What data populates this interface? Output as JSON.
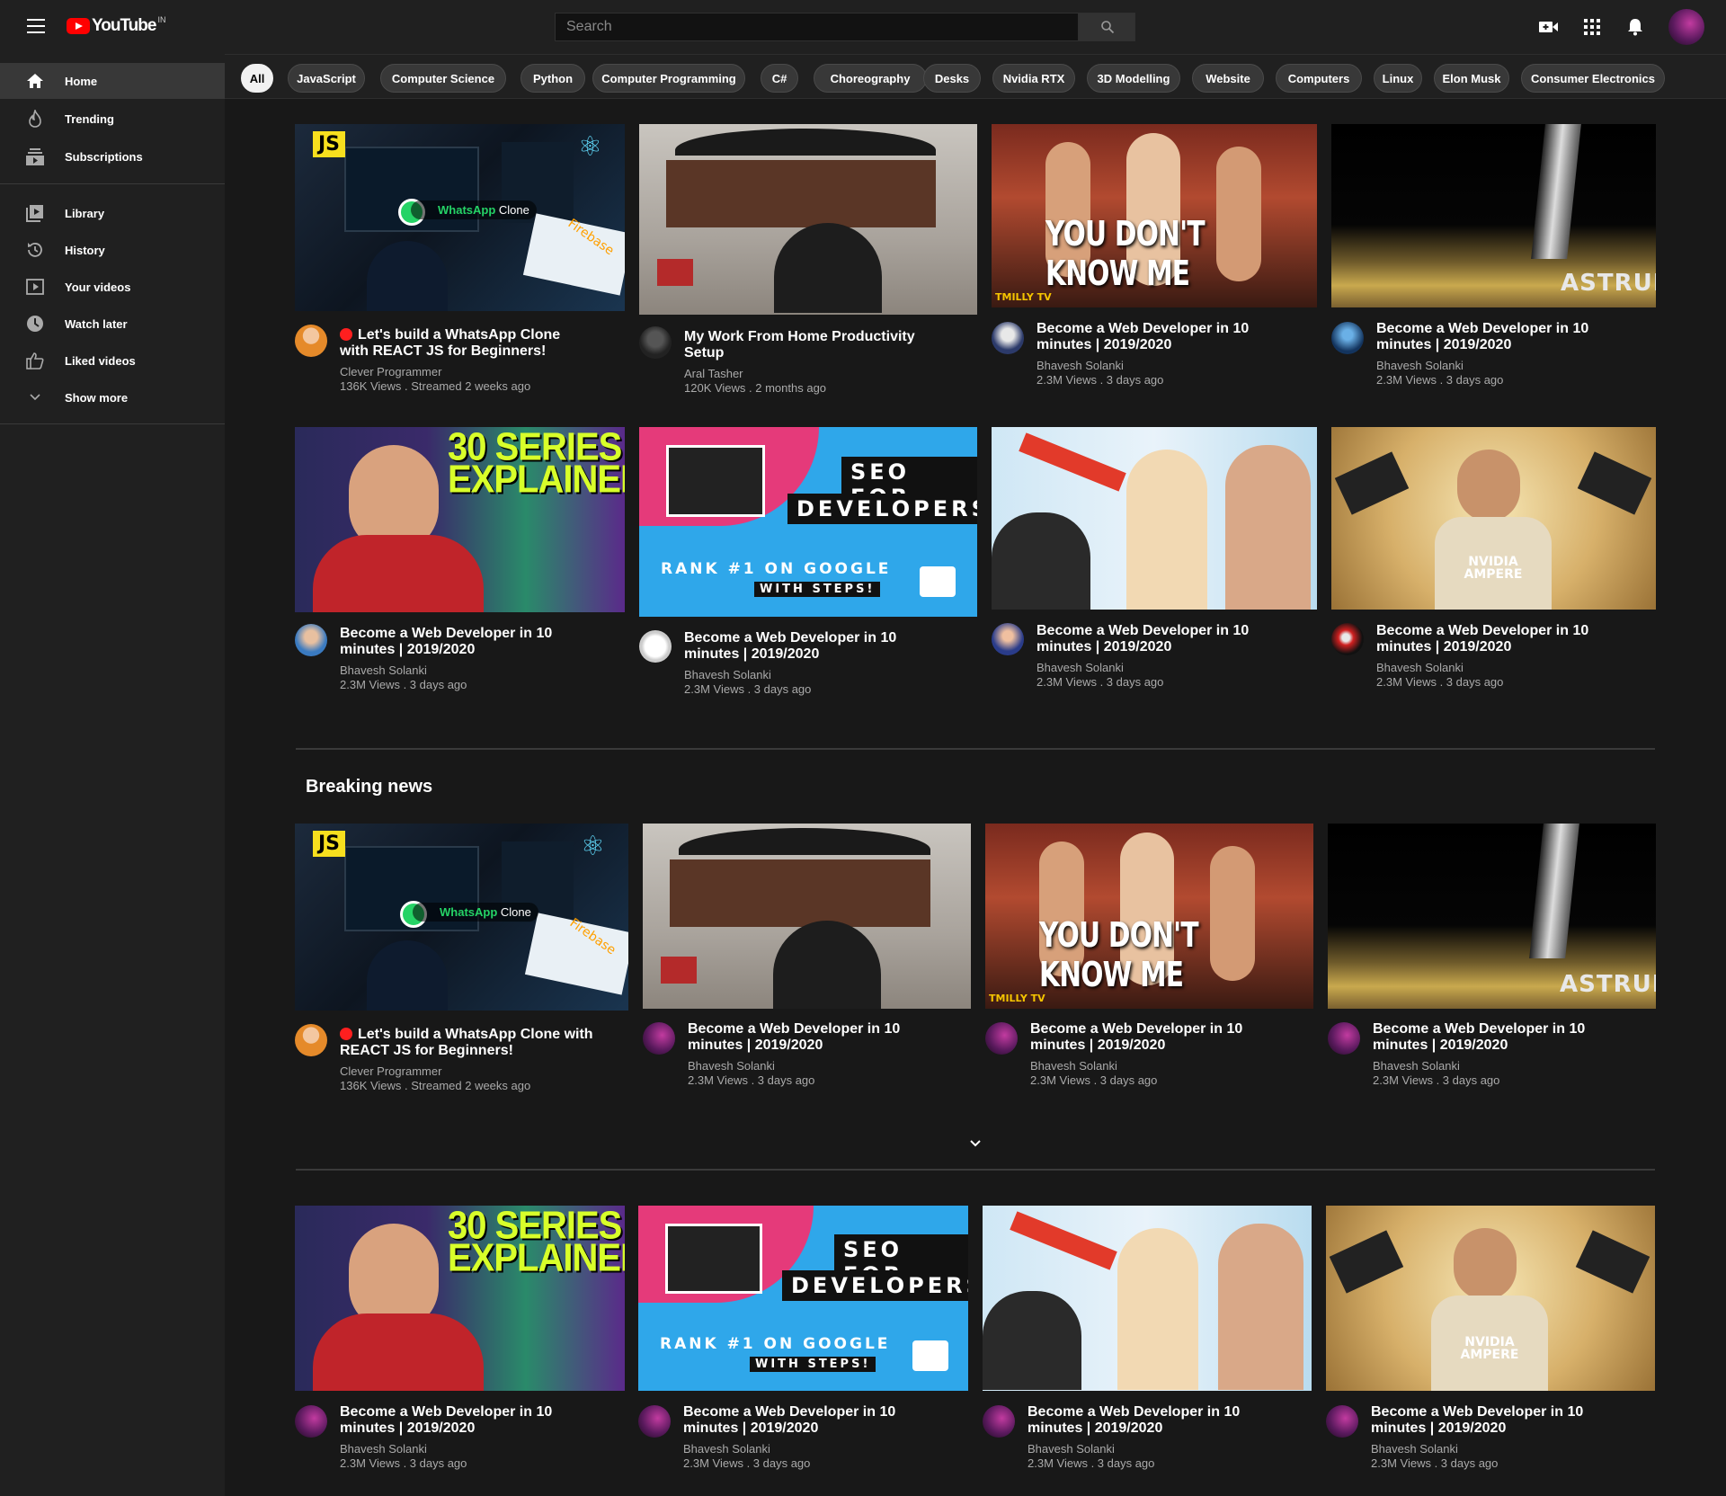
{
  "header": {
    "logo_text": "YouTube",
    "region": "IN",
    "search_placeholder": "Search"
  },
  "sidebar": {
    "items": [
      {
        "label": "Home",
        "icon": "home-icon"
      },
      {
        "label": "Trending",
        "icon": "fire-icon"
      },
      {
        "label": "Subscriptions",
        "icon": "subscriptions-icon"
      },
      {
        "label": "Library",
        "icon": "library-icon"
      },
      {
        "label": "History",
        "icon": "history-icon"
      },
      {
        "label": "Your videos",
        "icon": "your-videos-icon"
      },
      {
        "label": "Watch later",
        "icon": "clock-icon"
      },
      {
        "label": "Liked videos",
        "icon": "thumbs-up-icon"
      },
      {
        "label": "Show more",
        "icon": "chevron-down-icon"
      }
    ]
  },
  "chips": [
    "All",
    "JavaScript",
    "Computer Science",
    "Python",
    "Computer Programming",
    "C#",
    "Choreography",
    "Desks",
    "Nvidia RTX",
    "3D Modelling",
    "Website",
    "Computers",
    "Linux",
    "Elon Musk",
    "Consumer Electronics"
  ],
  "thumb_text": {
    "js": "JS",
    "whatsapp": "WhatsApp",
    "clone": "Clone",
    "firebase": "Firebase",
    "ydk": "YOU DON'T KNOW ME",
    "tmilly": "TMILLY TV",
    "astrum": "ASTRUM",
    "thirty_1": "30 SERIES",
    "thirty_2": "EXPLAINED!",
    "seo_1": "SEO FOR",
    "seo_2": "DEVELOPERS",
    "rank": "RANK #1 ON GOOGLE",
    "steps": "WITH STEPS!",
    "nvidia_1": "NVIDIA",
    "nvidia_2": "AMPERE"
  },
  "section": {
    "breaking_news": "Breaking news"
  },
  "videos": {
    "r1": [
      {
        "title_1": "Let's build a WhatsApp Clone",
        "title_2": "with REACT JS for Beginners!",
        "channel": "Clever Programmer",
        "meta": "136K Views . Streamed 2 weeks ago"
      },
      {
        "title_1": "My Work From Home Productivity",
        "title_2": "Setup",
        "channel": "Aral Tasher",
        "meta": "120K Views . 2 months ago"
      },
      {
        "title_1": "Become a Web Developer in 10",
        "title_2": "minutes | 2019/2020",
        "channel": "Bhavesh Solanki",
        "meta": "2.3M Views . 3 days ago"
      },
      {
        "title_1": "Become a Web Developer in 10",
        "title_2": "minutes | 2019/2020",
        "channel": "Bhavesh Solanki",
        "meta": "2.3M Views . 3 days ago"
      }
    ],
    "r2": [
      {
        "title_1": "Become a Web Developer in 10",
        "title_2": "minutes | 2019/2020",
        "channel": "Bhavesh Solanki",
        "meta": "2.3M Views . 3 days ago"
      },
      {
        "title_1": "Become a Web Developer in 10",
        "title_2": "minutes | 2019/2020",
        "channel": "Bhavesh Solanki",
        "meta": "2.3M Views . 3 days ago"
      },
      {
        "title_1": "Become a Web Developer in 10",
        "title_2": "minutes | 2019/2020",
        "channel": "Bhavesh Solanki",
        "meta": "2.3M Views . 3 days ago"
      },
      {
        "title_1": "Become a Web Developer in 10",
        "title_2": "minutes | 2019/2020",
        "channel": "Bhavesh Solanki",
        "meta": "2.3M Views . 3 days ago"
      }
    ],
    "r3": [
      {
        "title_1": "Let's build a WhatsApp Clone with",
        "title_2": "REACT JS for Beginners!",
        "channel": "Clever Programmer",
        "meta": "136K Views . Streamed 2 weeks ago"
      },
      {
        "title_1": "Become a Web Developer in 10",
        "title_2": "minutes | 2019/2020",
        "channel": "Bhavesh Solanki",
        "meta": "2.3M Views . 3 days ago"
      },
      {
        "title_1": "Become a Web Developer in 10",
        "title_2": "minutes | 2019/2020",
        "channel": "Bhavesh Solanki",
        "meta": "2.3M Views . 3 days ago"
      },
      {
        "title_1": "Become a Web Developer in 10",
        "title_2": "minutes | 2019/2020",
        "channel": "Bhavesh Solanki",
        "meta": "2.3M Views . 3 days ago"
      }
    ],
    "r4": [
      {
        "title_1": "Become a Web Developer in 10",
        "title_2": "minutes | 2019/2020",
        "channel": "Bhavesh Solanki",
        "meta": "2.3M Views . 3 days ago"
      },
      {
        "title_1": "Become a Web Developer in 10",
        "title_2": "minutes | 2019/2020",
        "channel": "Bhavesh Solanki",
        "meta": "2.3M Views . 3 days ago"
      },
      {
        "title_1": "Become a Web Developer in 10",
        "title_2": "minutes | 2019/2020",
        "channel": "Bhavesh Solanki",
        "meta": "2.3M Views . 3 days ago"
      },
      {
        "title_1": "Become a Web Developer in 10",
        "title_2": "minutes | 2019/2020",
        "channel": "Bhavesh Solanki",
        "meta": "2.3M Views . 3 days ago"
      }
    ]
  },
  "colors": {
    "background": "#181818",
    "surface": "#202020",
    "brand_red": "#ff0000",
    "secondary_text": "#aaaaaa"
  }
}
